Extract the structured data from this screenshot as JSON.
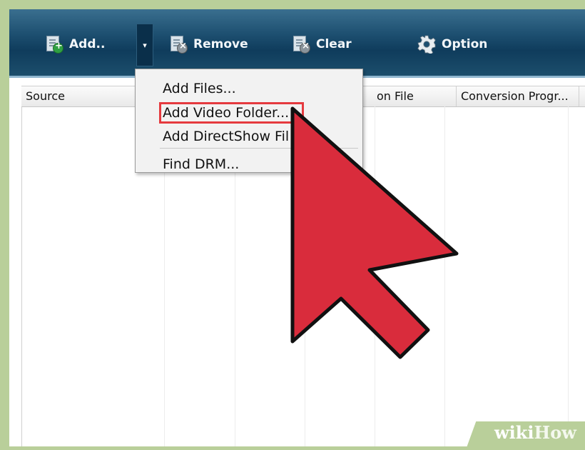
{
  "toolbar": {
    "add_label": "Add..",
    "remove_label": "Remove",
    "clear_label": "Clear",
    "option_label": "Option",
    "dropdown_icon": "chevron-down-icon"
  },
  "table": {
    "columns": [
      "Source",
      "on File",
      "Conversion Progr..."
    ]
  },
  "menu": {
    "items": [
      "Add Files...",
      "Add Video Folder...",
      "Add DirectShow Fil",
      "Find DRM..."
    ]
  },
  "watermark": {
    "part1": "wiki",
    "part2": "How"
  },
  "colors": {
    "toolbar": "#1d4f70",
    "highlight": "#e53a3f",
    "cursor": "#d92c3c",
    "background": "#b9cf9a"
  }
}
